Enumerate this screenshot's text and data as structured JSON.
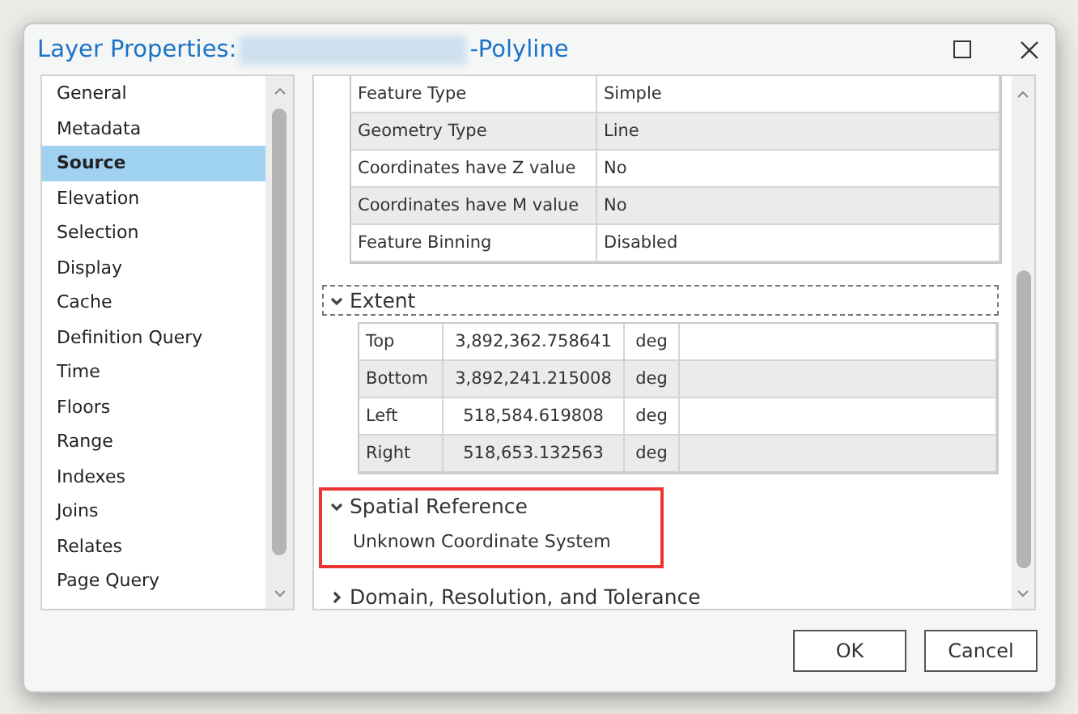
{
  "window": {
    "title_prefix": "Layer Properties:",
    "redacted": true,
    "title_suffix": "-Polyline"
  },
  "sidebar": {
    "items": [
      {
        "label": "General",
        "selected": false
      },
      {
        "label": "Metadata",
        "selected": false
      },
      {
        "label": "Source",
        "selected": true
      },
      {
        "label": "Elevation",
        "selected": false
      },
      {
        "label": "Selection",
        "selected": false
      },
      {
        "label": "Display",
        "selected": false
      },
      {
        "label": "Cache",
        "selected": false
      },
      {
        "label": "Definition Query",
        "selected": false
      },
      {
        "label": "Time",
        "selected": false
      },
      {
        "label": "Floors",
        "selected": false
      },
      {
        "label": "Range",
        "selected": false
      },
      {
        "label": "Indexes",
        "selected": false
      },
      {
        "label": "Joins",
        "selected": false
      },
      {
        "label": "Relates",
        "selected": false
      },
      {
        "label": "Page Query",
        "selected": false
      }
    ]
  },
  "properties_table": {
    "rows": [
      [
        "Feature Type",
        "Simple"
      ],
      [
        "Geometry Type",
        "Line"
      ],
      [
        "Coordinates have Z value",
        "No"
      ],
      [
        "Coordinates have M value",
        "No"
      ],
      [
        "Feature Binning",
        "Disabled"
      ]
    ]
  },
  "sections": [
    {
      "kind": "table",
      "title": "Extent",
      "expanded": true,
      "focused": true,
      "highlighted": false,
      "rows": [
        [
          "Top",
          "3,892,362.758641",
          "deg"
        ],
        [
          "Bottom",
          "3,892,241.215008",
          "deg"
        ],
        [
          "Left",
          "518,584.619808",
          "deg"
        ],
        [
          "Right",
          "518,653.132563",
          "deg"
        ]
      ]
    },
    {
      "kind": "text",
      "title": "Spatial Reference",
      "expanded": true,
      "focused": false,
      "highlighted": true,
      "text": "Unknown Coordinate System"
    },
    {
      "title": "Domain, Resolution, and Tolerance",
      "expanded": false,
      "focused": false,
      "highlighted": false
    }
  ],
  "buttons": [
    {
      "label": "OK"
    },
    {
      "label": "Cancel"
    }
  ]
}
